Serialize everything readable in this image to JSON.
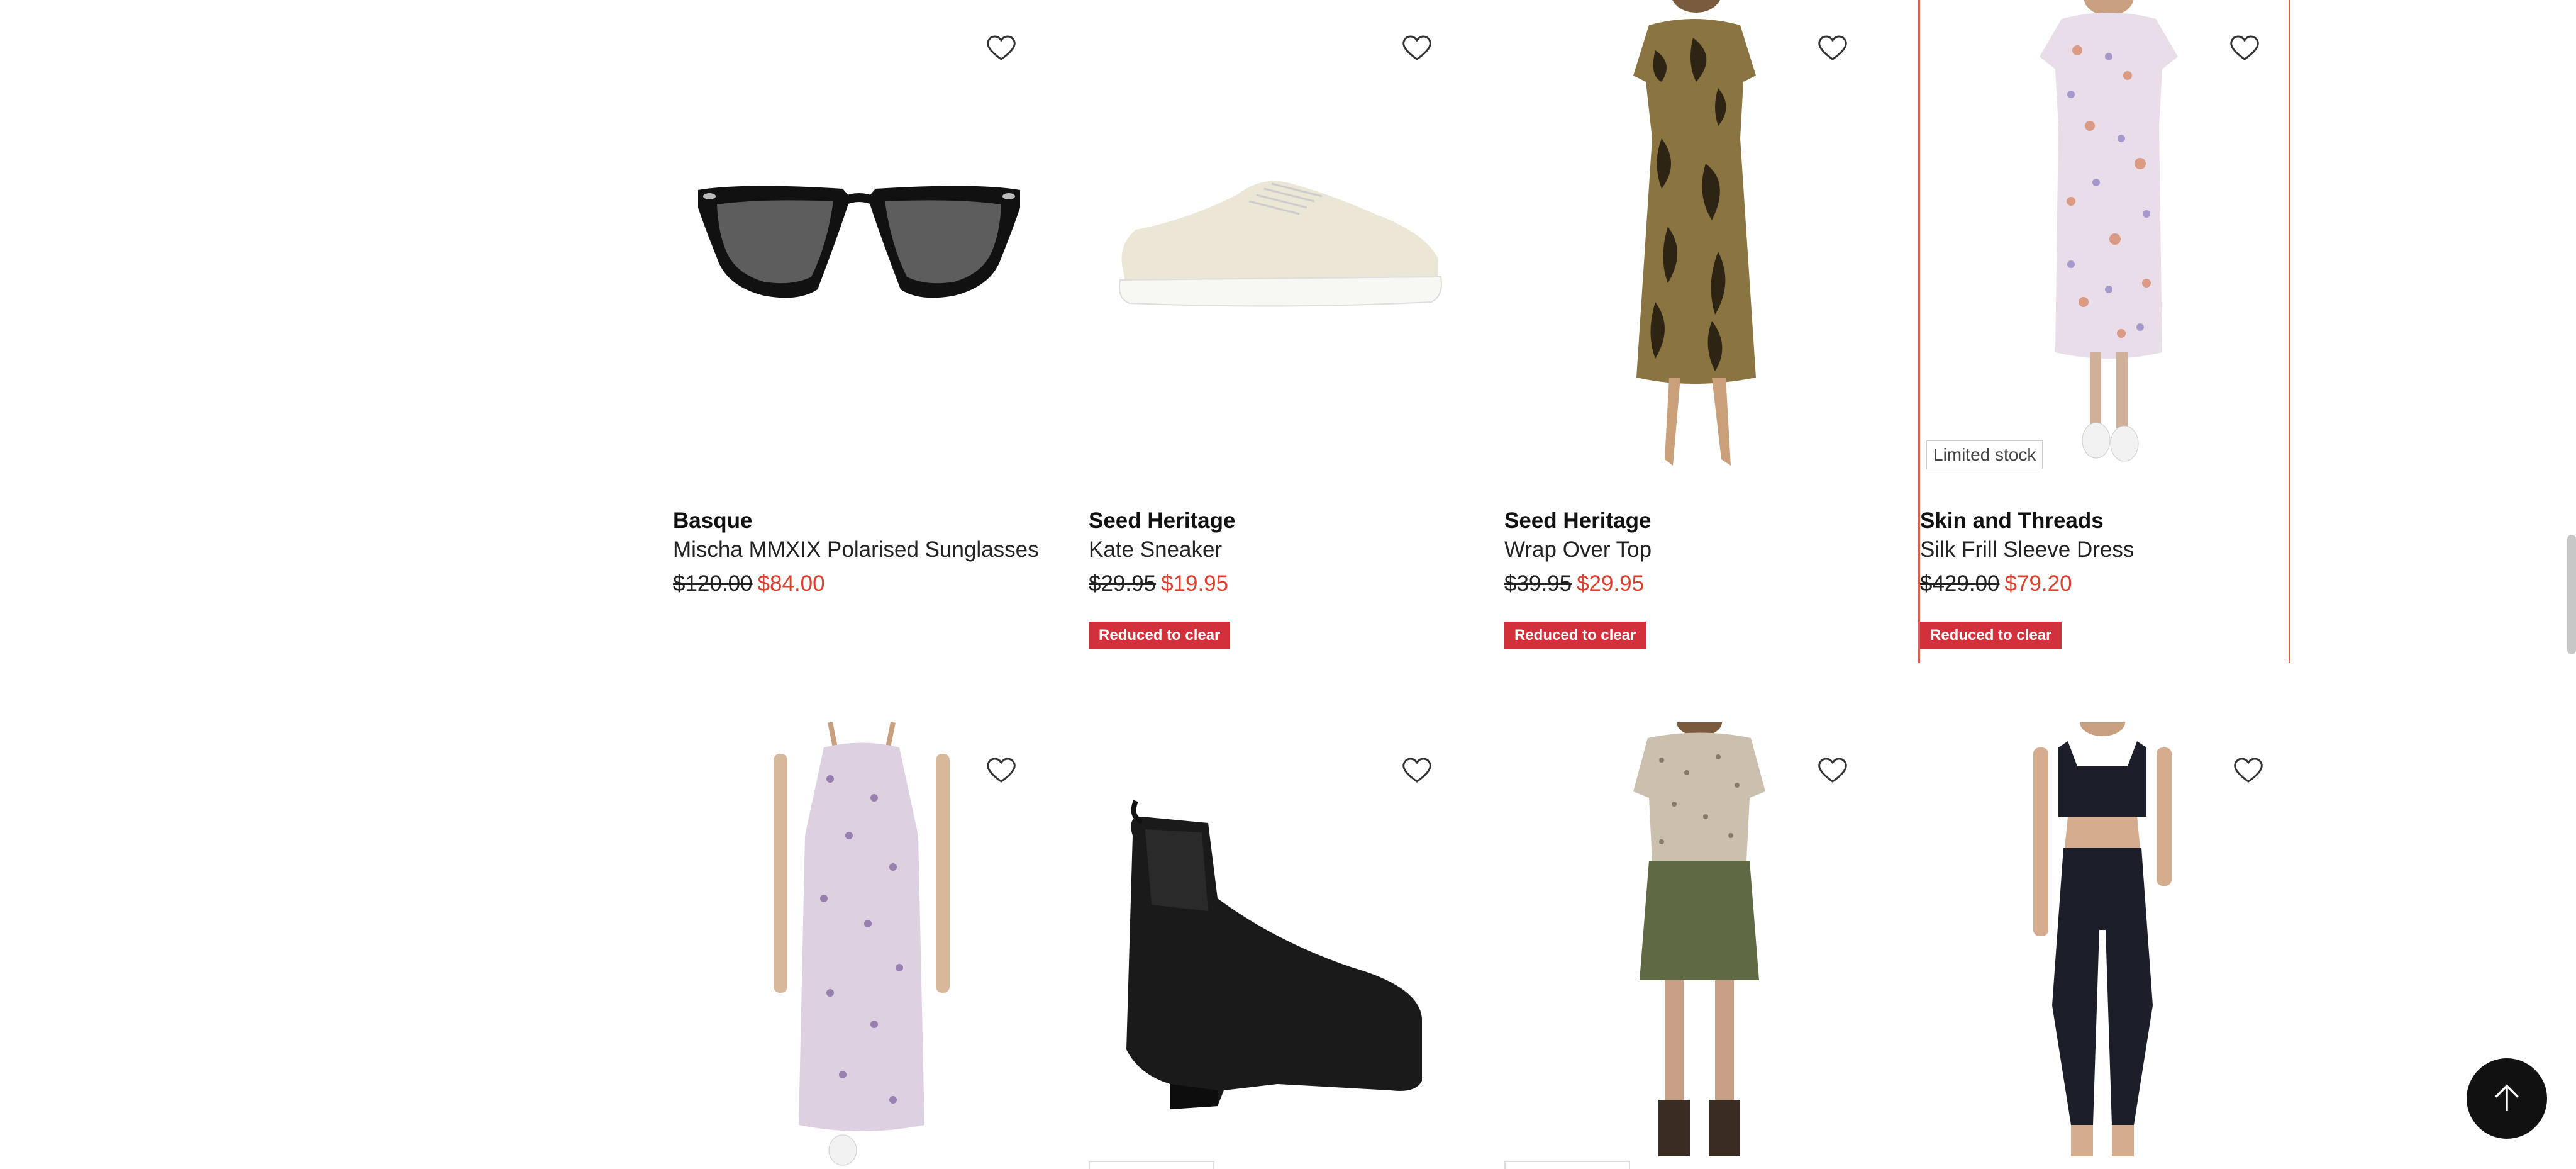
{
  "products": [
    {
      "brand": "Basque",
      "name": "Mischa MMXIX Polarised Sunglasses",
      "was": "$120.00",
      "now": "$84.00",
      "tag": "",
      "image": "sunglasses"
    },
    {
      "brand": "Seed Heritage",
      "name": "Kate Sneaker",
      "was": "$29.95",
      "now": "$19.95",
      "tag": "Reduced to clear",
      "image": "sneaker"
    },
    {
      "brand": "Seed Heritage",
      "name": "Wrap Over Top",
      "was": "$39.95",
      "now": "$29.95",
      "tag": "Reduced to clear",
      "image": "wrap-dress"
    },
    {
      "brand": "Skin and Threads",
      "name": "Silk Frill Sleeve Dress",
      "was": "$429.00",
      "now": "$79.20",
      "tag": "Reduced to clear",
      "badge": "Limited stock",
      "image": "floral-dress"
    }
  ],
  "row2_images": [
    "floral-slip-dress",
    "ankle-boot",
    "tee-and-skirt",
    "crop-top-and-pants"
  ],
  "icons": {
    "wishlist": "heart-outline-icon",
    "back_to_top": "arrow-up-icon"
  },
  "colors": {
    "sale_price": "#d9412f",
    "tag_bg": "#d2313c",
    "highlight_border": "#e05a5a"
  }
}
